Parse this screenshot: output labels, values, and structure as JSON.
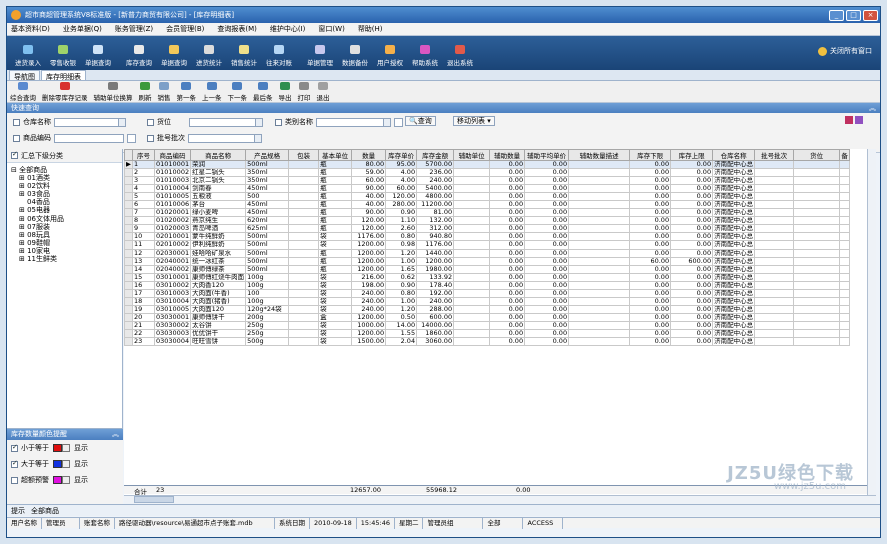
{
  "title": "超市商超管理系统V8标准版 - [新普力商贸有限公司] - [库存明细表]",
  "menu": [
    "基本资料(D)",
    "业务单据(Q)",
    "账务管理(Z)",
    "会员管理(B)",
    "查询报表(M)",
    "维护中心(I)",
    "窗口(W)",
    "帮助(H)"
  ],
  "toolbar1": [
    "进货录入",
    "零售收银",
    "单据查询",
    "库存查询",
    "单据查询",
    "进货统计",
    "销售统计",
    "往来对账",
    "单据管理",
    "数据备份",
    "用户授权",
    "帮助系统",
    "退出系统"
  ],
  "exit_label": "关闭所有窗口",
  "tabs": [
    "导航图",
    "库存明细表"
  ],
  "toolbar2": [
    "综合查询",
    "删除零库存记录",
    "辅助单位换算",
    "刷新",
    "销售",
    "第一条",
    "上一条",
    "下一条",
    "最后条",
    "导出",
    "打印",
    "退出"
  ],
  "section_title": "快速查询",
  "filter": {
    "warehouse_label": "仓库名称",
    "location_label": "货位",
    "category_label": "类别名称",
    "product_label": "商品编码",
    "batch_label": "批号批次",
    "query_btn": "查询",
    "move_btn": "移动列表"
  },
  "tree": {
    "header": "汇总下级分类",
    "items": [
      "全部商品",
      "01酒类",
      "02饮料",
      "03食品",
      "04香品",
      "05电器",
      "06文体用品",
      "07服装",
      "08玩具",
      "09鞋帽",
      "10家电",
      "11生鲜类"
    ]
  },
  "options": {
    "title": "库存数量颜色提醒",
    "rows": [
      {
        "label": "小于等于",
        "action": "显示",
        "color": "#e01010"
      },
      {
        "label": "大于等于",
        "action": "显示",
        "color": "#1030e0"
      },
      {
        "label": "超额预警",
        "action": "显示",
        "color": "#e010e0"
      }
    ]
  },
  "columns": [
    "序号",
    "商品编码",
    "商品名称",
    "产品规格",
    "包装",
    "基本单位",
    "数量",
    "库存单价",
    "库存金额",
    "辅助单位",
    "辅助数量",
    "辅助平均单价",
    "辅助数量描述",
    "库存下限",
    "库存上限",
    "仓库名称",
    "批号批次",
    "货位",
    "备"
  ],
  "rows": [
    [
      "1",
      "01010001",
      "荣润",
      "500ml",
      "",
      "瓶",
      "80.00",
      "95.00",
      "5700.00",
      "",
      "0.00",
      "0.00",
      "",
      "0.00",
      "0.00",
      "济南配中心总"
    ],
    [
      "2",
      "01010002",
      "红星二锅头",
      "350ml",
      "",
      "瓶",
      "59.00",
      "4.00",
      "236.00",
      "",
      "0.00",
      "0.00",
      "",
      "0.00",
      "0.00",
      "济南配中心总"
    ],
    [
      "3",
      "01010003",
      "北京二锅头",
      "350ml",
      "",
      "瓶",
      "60.00",
      "4.00",
      "240.00",
      "",
      "0.00",
      "0.00",
      "",
      "0.00",
      "0.00",
      "济南配中心总"
    ],
    [
      "4",
      "01010004",
      "剑南春",
      "450ml",
      "",
      "瓶",
      "90.00",
      "60.00",
      "5400.00",
      "",
      "0.00",
      "0.00",
      "",
      "0.00",
      "0.00",
      "济南配中心总"
    ],
    [
      "5",
      "01010005",
      "五粮液",
      "500",
      "",
      "瓶",
      "40.00",
      "120.00",
      "4800.00",
      "",
      "0.00",
      "0.00",
      "",
      "0.00",
      "0.00",
      "济南配中心总"
    ],
    [
      "6",
      "01010006",
      "茅台",
      "450ml",
      "",
      "瓶",
      "40.00",
      "280.00",
      "11200.00",
      "",
      "0.00",
      "0.00",
      "",
      "0.00",
      "0.00",
      "济南配中心总"
    ],
    [
      "7",
      "01020001",
      "绿小麦啤",
      "450ml",
      "",
      "瓶",
      "90.00",
      "0.90",
      "81.00",
      "",
      "0.00",
      "0.00",
      "",
      "0.00",
      "0.00",
      "济南配中心总"
    ],
    [
      "8",
      "01020002",
      "燕京纯生",
      "620ml",
      "",
      "瓶",
      "120.00",
      "1.10",
      "132.00",
      "",
      "0.00",
      "0.00",
      "",
      "0.00",
      "0.00",
      "济南配中心总"
    ],
    [
      "9",
      "01020003",
      "青岛啤酒",
      "625ml",
      "",
      "瓶",
      "120.00",
      "2.60",
      "312.00",
      "",
      "0.00",
      "0.00",
      "",
      "0.00",
      "0.00",
      "济南配中心总"
    ],
    [
      "10",
      "02010001",
      "蒙牛纯鲜奶",
      "500ml",
      "",
      "袋",
      "1176.00",
      "0.80",
      "940.80",
      "",
      "0.00",
      "0.00",
      "",
      "0.00",
      "0.00",
      "济南配中心总"
    ],
    [
      "11",
      "02010002",
      "伊利纯鲜奶",
      "500ml",
      "",
      "袋",
      "1200.00",
      "0.98",
      "1176.00",
      "",
      "0.00",
      "0.00",
      "",
      "0.00",
      "0.00",
      "济南配中心总"
    ],
    [
      "12",
      "02030001",
      "娃哈哈矿泉水",
      "500ml",
      "",
      "瓶",
      "1200.00",
      "1.20",
      "1440.00",
      "",
      "0.00",
      "0.00",
      "",
      "0.00",
      "0.00",
      "济南配中心总"
    ],
    [
      "13",
      "02040001",
      "统一冰红茶",
      "500ml",
      "",
      "瓶",
      "1200.00",
      "1.00",
      "1200.00",
      "",
      "0.00",
      "0.00",
      "",
      "60.00",
      "600.00",
      "济南配中心总"
    ],
    [
      "14",
      "02040002",
      "康师傅绿茶",
      "500ml",
      "",
      "瓶",
      "1200.00",
      "1.65",
      "1980.00",
      "",
      "0.00",
      "0.00",
      "",
      "0.00",
      "0.00",
      "济南配中心总"
    ],
    [
      "15",
      "03010001",
      "康师傅红烧牛肉面",
      "100g",
      "",
      "袋",
      "216.00",
      "0.62",
      "133.92",
      "",
      "0.00",
      "0.00",
      "",
      "0.00",
      "0.00",
      "济南配中心总"
    ],
    [
      "16",
      "03010002",
      "大肉香120",
      "100g",
      "",
      "袋",
      "198.00",
      "0.90",
      "178.40",
      "",
      "0.00",
      "0.00",
      "",
      "0.00",
      "0.00",
      "济南配中心总"
    ],
    [
      "17",
      "03010003",
      "大肉面(牛香)",
      "100",
      "",
      "袋",
      "240.00",
      "0.80",
      "192.00",
      "",
      "0.00",
      "0.00",
      "",
      "0.00",
      "0.00",
      "济南配中心总"
    ],
    [
      "18",
      "03010004",
      "大肉面(猪香)",
      "100g",
      "",
      "袋",
      "240.00",
      "1.00",
      "240.00",
      "",
      "0.00",
      "0.00",
      "",
      "0.00",
      "0.00",
      "济南配中心总"
    ],
    [
      "19",
      "03010005",
      "大肉面120",
      "120g*24袋",
      "",
      "袋",
      "240.00",
      "1.20",
      "288.00",
      "",
      "0.00",
      "0.00",
      "",
      "0.00",
      "0.00",
      "济南配中心总"
    ],
    [
      "20",
      "03030001",
      "康师傅饼干",
      "200g",
      "",
      "盒",
      "1200.00",
      "0.50",
      "600.00",
      "",
      "0.00",
      "0.00",
      "",
      "0.00",
      "0.00",
      "济南配中心总"
    ],
    [
      "21",
      "03030002",
      "太谷饼",
      "250g",
      "",
      "袋",
      "1000.00",
      "14.00",
      "14000.00",
      "",
      "0.00",
      "0.00",
      "",
      "0.00",
      "0.00",
      "济南配中心总"
    ],
    [
      "22",
      "03030003",
      "优优饼干",
      "250g",
      "",
      "袋",
      "1200.00",
      "1.55",
      "1860.00",
      "",
      "0.00",
      "0.00",
      "",
      "0.00",
      "0.00",
      "济南配中心总"
    ],
    [
      "23",
      "03030004",
      "旺旺雪饼",
      "500g",
      "",
      "袋",
      "1500.00",
      "2.04",
      "3060.00",
      "",
      "0.00",
      "0.00",
      "",
      "0.00",
      "0.00",
      "济南配中心总"
    ]
  ],
  "totals": {
    "label": "合计",
    "count": "23",
    "qty": "12657.00",
    "amount": "55968.12",
    "aux": "0.00"
  },
  "bottom_tabs": [
    "提示",
    "全部商品"
  ],
  "status": [
    "用户名称",
    "管理员",
    "账套名称",
    "路径驱动器\\resource\\易通超市点子账套.mdb",
    "系统日期",
    "2010-09-18",
    "15:45:46",
    "星期二",
    "管理员组",
    "全部",
    "ACCESS"
  ],
  "watermark": [
    "JZ5U绿色下载",
    "www.jz5u.com"
  ]
}
